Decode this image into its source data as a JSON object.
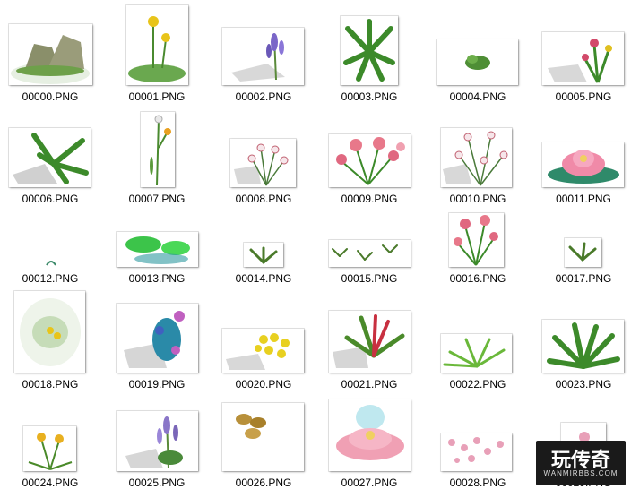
{
  "files": [
    {
      "name": "00000.PNG",
      "icon": "rock-icon"
    },
    {
      "name": "00001.PNG",
      "icon": "yellow-flower-icon"
    },
    {
      "name": "00002.PNG",
      "icon": "lavender-icon"
    },
    {
      "name": "00003.PNG",
      "icon": "fern-icon"
    },
    {
      "name": "00004.PNG",
      "icon": "small-bush-icon"
    },
    {
      "name": "00005.PNG",
      "icon": "flower-bush-icon"
    },
    {
      "name": "00006.PNG",
      "icon": "fern-icon"
    },
    {
      "name": "00007.PNG",
      "icon": "lily-icon"
    },
    {
      "name": "00008.PNG",
      "icon": "white-flowers-icon"
    },
    {
      "name": "00009.PNG",
      "icon": "pink-flowers-icon"
    },
    {
      "name": "00010.PNG",
      "icon": "white-flowers-icon"
    },
    {
      "name": "00011.PNG",
      "icon": "lotus-icon"
    },
    {
      "name": "00012.PNG",
      "icon": "tiny-sprout-icon"
    },
    {
      "name": "00013.PNG",
      "icon": "lily-pads-icon"
    },
    {
      "name": "00014.PNG",
      "icon": "grass-sprig-icon"
    },
    {
      "name": "00015.PNG",
      "icon": "grass-sprigs-icon"
    },
    {
      "name": "00016.PNG",
      "icon": "pink-flowers-icon"
    },
    {
      "name": "00017.PNG",
      "icon": "grass-sprig-icon"
    },
    {
      "name": "00018.PNG",
      "icon": "yellow-flower-glow-icon"
    },
    {
      "name": "00019.PNG",
      "icon": "blue-flowers-icon"
    },
    {
      "name": "00020.PNG",
      "icon": "yellow-flowers-icon"
    },
    {
      "name": "00021.PNG",
      "icon": "bromeliad-icon"
    },
    {
      "name": "00022.PNG",
      "icon": "grass-tuft-icon"
    },
    {
      "name": "00023.PNG",
      "icon": "aloe-icon"
    },
    {
      "name": "00024.PNG",
      "icon": "yellow-lily-icon"
    },
    {
      "name": "00025.PNG",
      "icon": "lavender-icon"
    },
    {
      "name": "00026.PNG",
      "icon": "coins-icon"
    },
    {
      "name": "00027.PNG",
      "icon": "lotus-glow-icon"
    },
    {
      "name": "00028.PNG",
      "icon": "cherry-blossom-icon"
    },
    {
      "name": "00029.PNG",
      "icon": "pink-flower-icon"
    }
  ],
  "watermark": {
    "title": "玩传奇",
    "subtitle": "WANMIRBBS.COM"
  }
}
